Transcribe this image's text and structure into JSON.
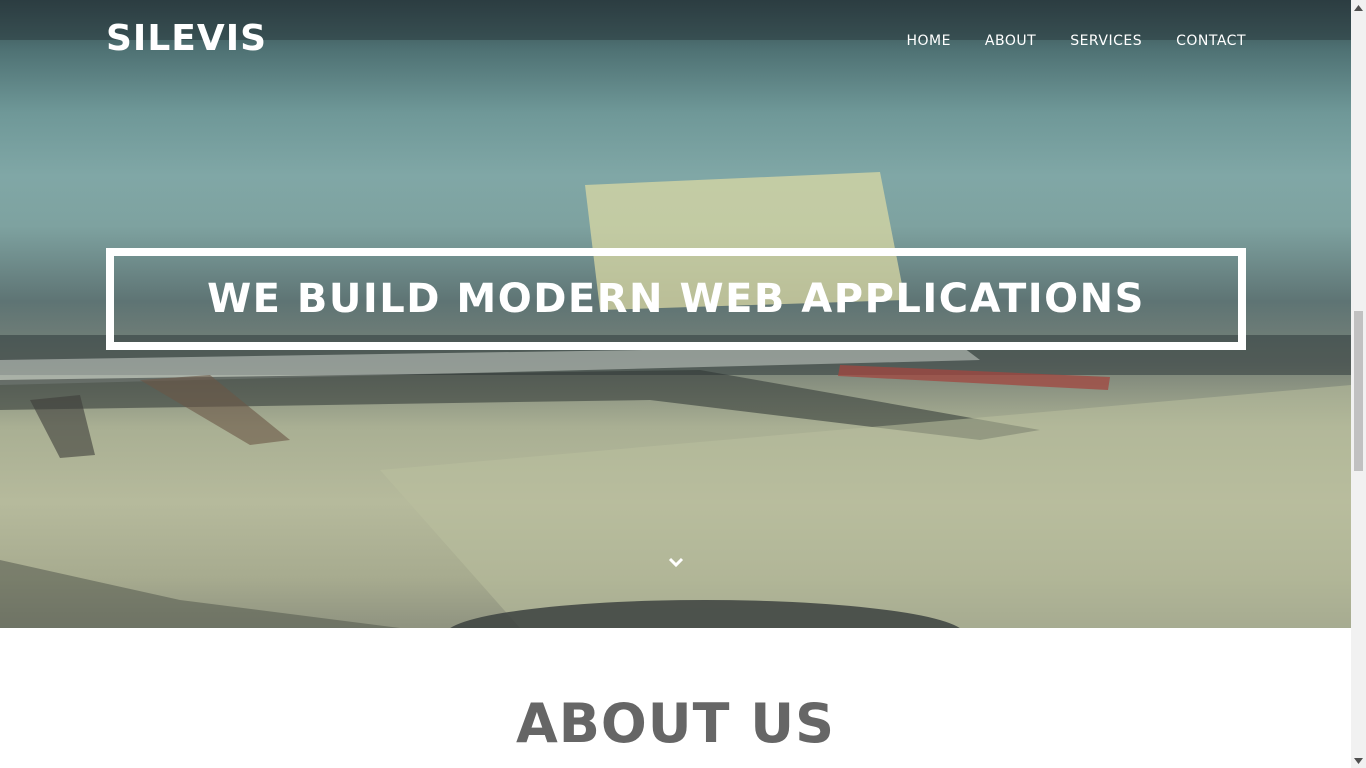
{
  "brand": {
    "logo": "SILEVIS"
  },
  "nav": {
    "items": [
      {
        "label": "HOME"
      },
      {
        "label": "ABOUT"
      },
      {
        "label": "SERVICES"
      },
      {
        "label": "CONTACT"
      }
    ]
  },
  "hero": {
    "headline": "WE BUILD MODERN WEB APPLICATIONS",
    "scroll_icon": "chevron-down-icon"
  },
  "about": {
    "title": "ABOUT US"
  },
  "colors": {
    "hero_text": "#ffffff",
    "about_title": "#666666",
    "scrollbar_track": "#f1f1f1",
    "scrollbar_thumb": "#c1c1c1"
  }
}
